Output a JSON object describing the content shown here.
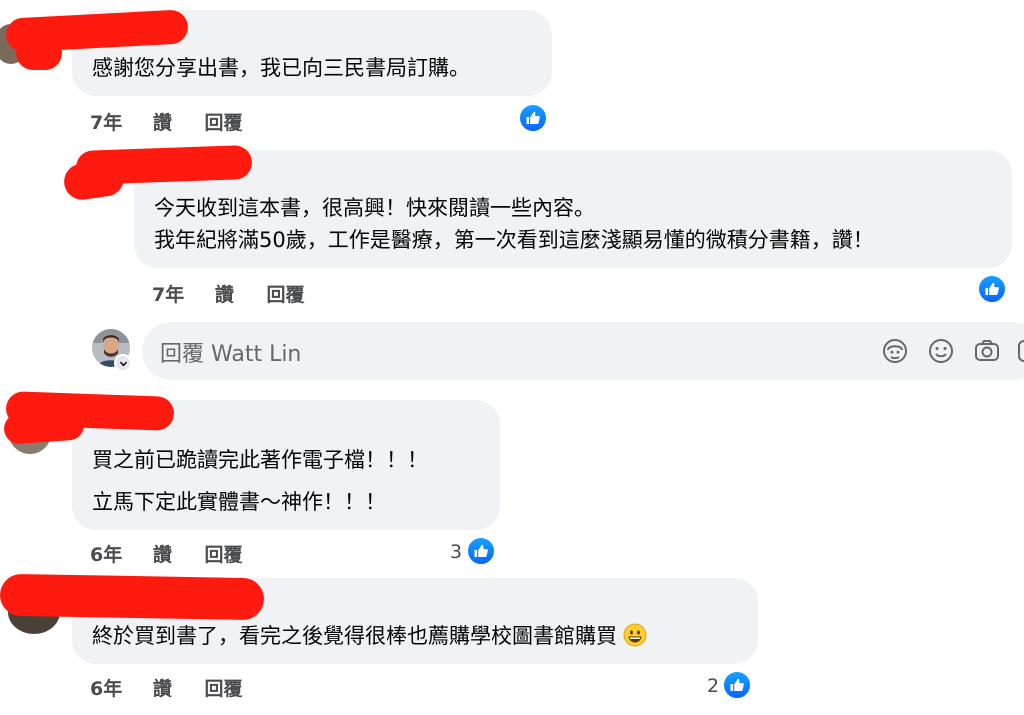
{
  "comments": [
    {
      "lines": [
        "感謝您分享出書，我已向三民書局訂購。"
      ],
      "time": "7年",
      "like_label": "讚",
      "reply_label": "回覆",
      "like_count": ""
    },
    {
      "lines": [
        "今天收到這本書，很高興！快來閱讀一些內容。",
        "我年紀將滿50歲，工作是醫療，第一次看到這麼淺顯易懂的微積分書籍，讚！"
      ],
      "time": "7年",
      "like_label": "讚",
      "reply_label": "回覆",
      "like_count": ""
    },
    {
      "lines": [
        "買之前已跪讀完此著作電子檔！！！",
        "立馬下定此實體書～神作！！！"
      ],
      "time": "6年",
      "like_label": "讚",
      "reply_label": "回覆",
      "like_count": "3"
    },
    {
      "lines": [
        "終於買到書了，看完之後覺得很棒也薦購學校圖書館購買"
      ],
      "time": "6年",
      "like_label": "讚",
      "reply_label": "回覆",
      "like_count": "2"
    }
  ],
  "reply_box": {
    "placeholder": "回覆 Watt Lin"
  },
  "icons": {
    "like": "thumbs-up-icon",
    "avatar_emoji": "avatar-sticker-icon",
    "emoji": "smile-icon",
    "camera": "camera-icon",
    "gif": "gif-icon",
    "grin": "grinning-face-icon"
  },
  "colors": {
    "bubble": "#f0f2f5",
    "like_blue": "#0866ff",
    "redaction": "#ff1a0f",
    "meta_text": "#4a4c50"
  }
}
